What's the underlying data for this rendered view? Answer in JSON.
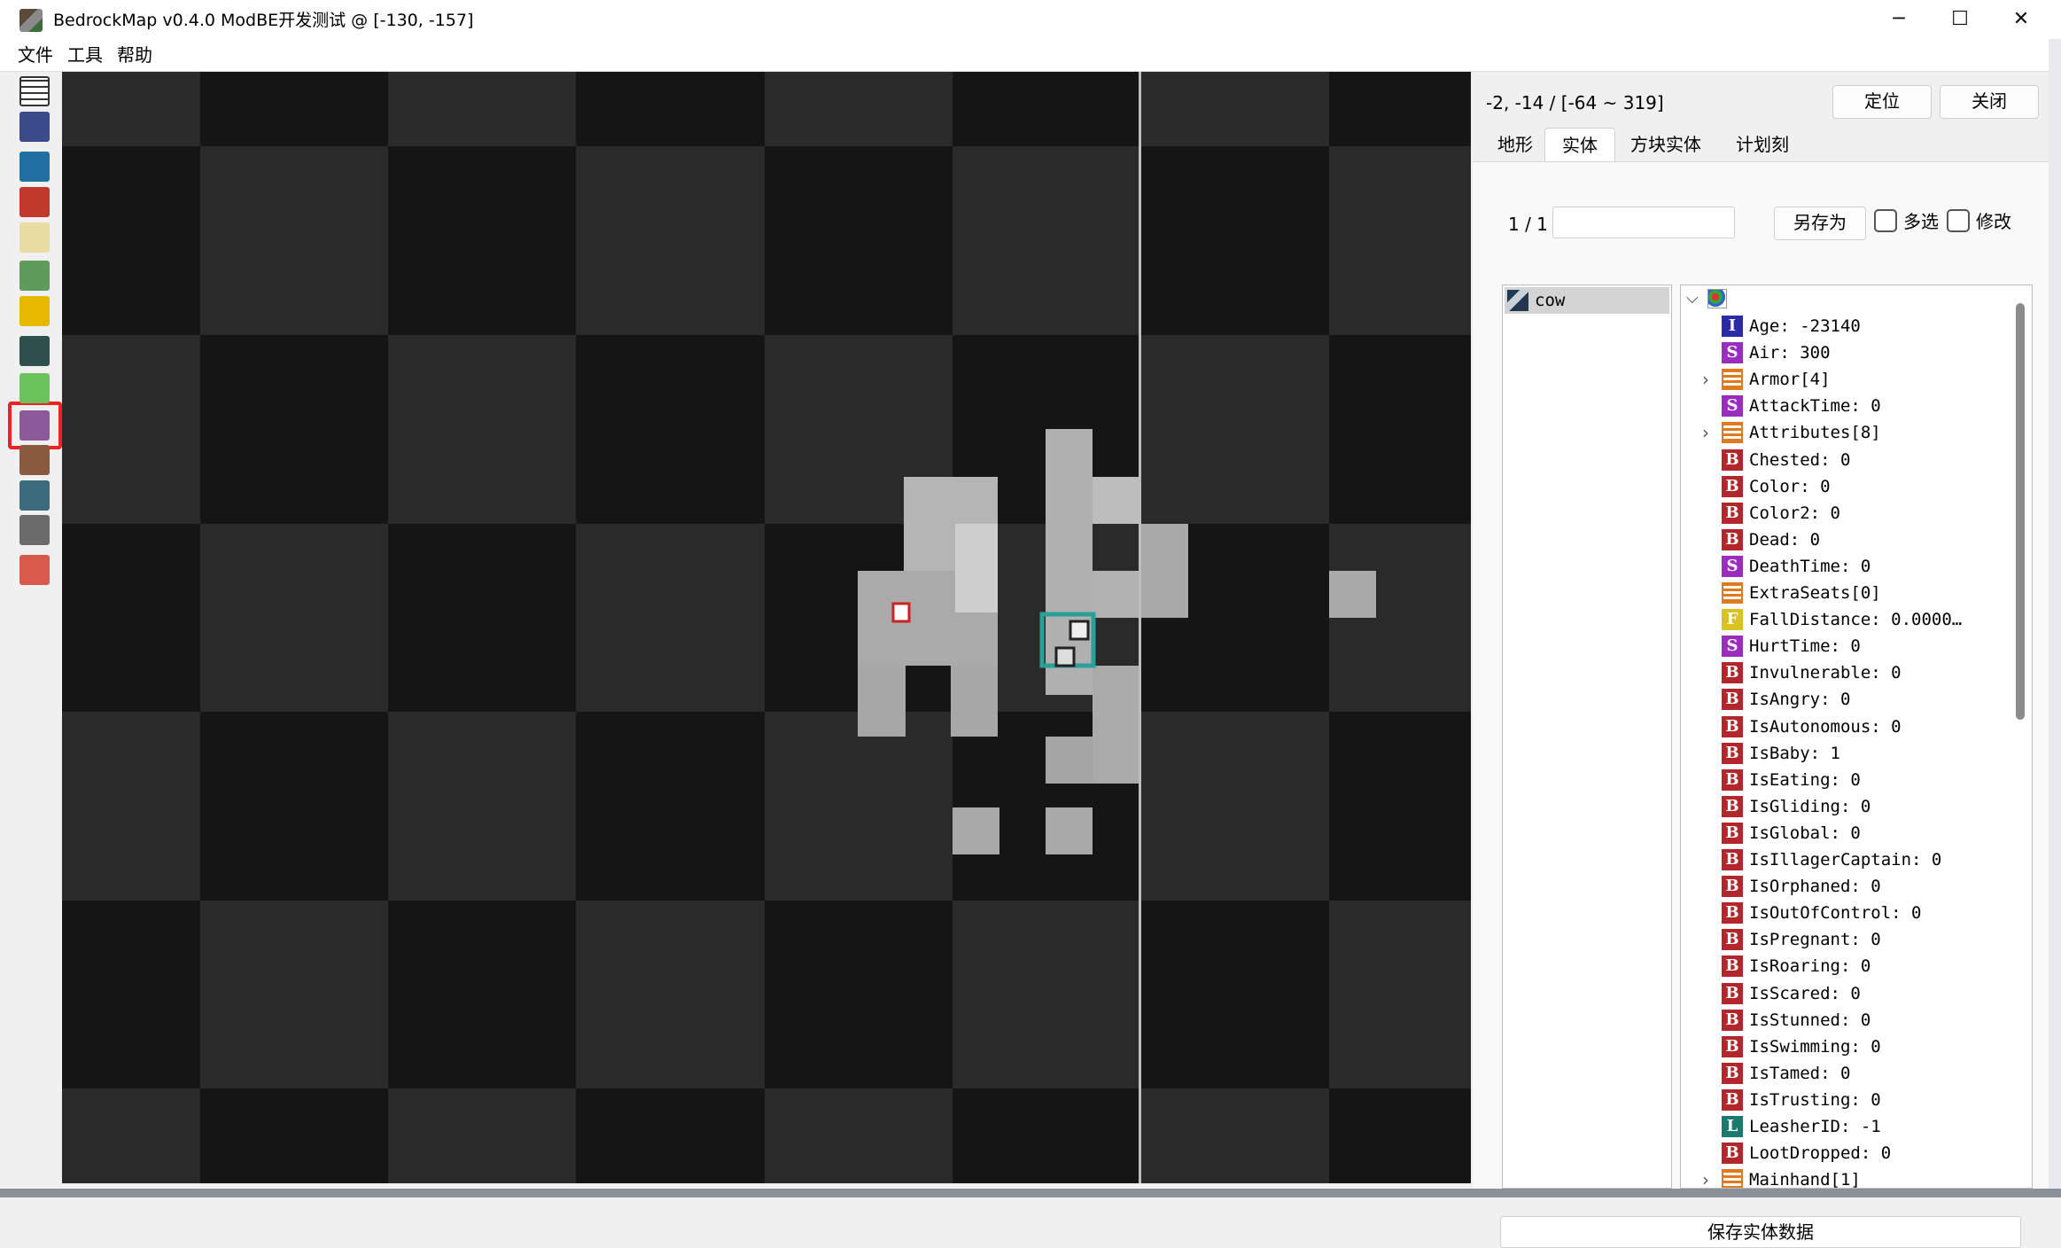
{
  "window": {
    "title": "BedrockMap v0.4.0 ModBE开发测试 @  [-130, -157]",
    "controls": {
      "minimize": "─",
      "maximize": "☐",
      "close": "✕"
    }
  },
  "menu": {
    "file": "文件",
    "tools": "工具",
    "help": "帮助"
  },
  "toolbar": {
    "tools": [
      {
        "name": "grid-tool-icon",
        "color": "#555555"
      },
      {
        "name": "selection-tool-icon",
        "color": "#3a4b8a"
      },
      {
        "name": "globe-icon",
        "color": "#1f6fa3"
      },
      {
        "name": "tnt-icon",
        "color": "#c0392b"
      },
      {
        "name": "dice-icon",
        "color": "#e9dca3"
      },
      {
        "name": "landscape-icon",
        "color": "#5d9c5a"
      },
      {
        "name": "paint-icon",
        "color": "#e4b900"
      },
      {
        "name": "entity-layer-icon",
        "color": "#2f4f4f"
      },
      {
        "name": "slime-icon",
        "color": "#6ac35b"
      },
      {
        "name": "actor-layer-icon",
        "color": "#8a5a9a"
      },
      {
        "name": "villager-icon",
        "color": "#8a5a3e"
      },
      {
        "name": "mob-layer-icon",
        "color": "#3b6c7c"
      },
      {
        "name": "anvil-icon",
        "color": "#6b6b6b"
      },
      {
        "name": "nbt-icon",
        "color": "#d95a4a"
      }
    ],
    "highlighted_tool": "entity-layer-icon"
  },
  "panel": {
    "coordinate": "-2, -14 / [-64 ~ 319]",
    "locate_button": "定位",
    "close_button": "关闭",
    "tabs": {
      "terrain": "地形",
      "entity": "实体",
      "block_entity": "方块实体",
      "scheduled_tick": "计划刻"
    },
    "active_tab": "实体",
    "page_indicator": "1 / 1",
    "search_value": "",
    "save_as_button": "另存为",
    "multi_select_label": "多选",
    "modify_label": "修改",
    "entity_list": [
      {
        "name": "cow"
      }
    ],
    "nbt_rows": [
      {
        "type": "I",
        "text": "Age: -23140",
        "color": "#2b2ba8",
        "expandable": false
      },
      {
        "type": "S",
        "text": "Air: 300",
        "color": "#9a2dbd",
        "expandable": false
      },
      {
        "type": "list",
        "text": "Armor[4]",
        "color": "#e07a1f",
        "expandable": true
      },
      {
        "type": "S",
        "text": "AttackTime: 0",
        "color": "#9a2dbd",
        "expandable": false
      },
      {
        "type": "list",
        "text": "Attributes[8]",
        "color": "#e07a1f",
        "expandable": true
      },
      {
        "type": "B",
        "text": "Chested: 0",
        "color": "#b3262c",
        "expandable": false
      },
      {
        "type": "B",
        "text": "Color: 0",
        "color": "#b3262c",
        "expandable": false
      },
      {
        "type": "B",
        "text": "Color2: 0",
        "color": "#b3262c",
        "expandable": false
      },
      {
        "type": "B",
        "text": "Dead: 0",
        "color": "#b3262c",
        "expandable": false
      },
      {
        "type": "S",
        "text": "DeathTime: 0",
        "color": "#9a2dbd",
        "expandable": false
      },
      {
        "type": "list",
        "text": "ExtraSeats[0]",
        "color": "#e07a1f",
        "expandable": false
      },
      {
        "type": "F",
        "text": "FallDistance: 0.0000…",
        "color": "#d9c323",
        "expandable": false
      },
      {
        "type": "S",
        "text": "HurtTime: 0",
        "color": "#9a2dbd",
        "expandable": false
      },
      {
        "type": "B",
        "text": "Invulnerable: 0",
        "color": "#b3262c",
        "expandable": false
      },
      {
        "type": "B",
        "text": "IsAngry: 0",
        "color": "#b3262c",
        "expandable": false
      },
      {
        "type": "B",
        "text": "IsAutonomous: 0",
        "color": "#b3262c",
        "expandable": false
      },
      {
        "type": "B",
        "text": "IsBaby: 1",
        "color": "#b3262c",
        "expandable": false
      },
      {
        "type": "B",
        "text": "IsEating: 0",
        "color": "#b3262c",
        "expandable": false
      },
      {
        "type": "B",
        "text": "IsGliding: 0",
        "color": "#b3262c",
        "expandable": false
      },
      {
        "type": "B",
        "text": "IsGlobal: 0",
        "color": "#b3262c",
        "expandable": false
      },
      {
        "type": "B",
        "text": "IsIllagerCaptain: 0",
        "color": "#b3262c",
        "expandable": false
      },
      {
        "type": "B",
        "text": "IsOrphaned: 0",
        "color": "#b3262c",
        "expandable": false
      },
      {
        "type": "B",
        "text": "IsOutOfControl: 0",
        "color": "#b3262c",
        "expandable": false
      },
      {
        "type": "B",
        "text": "IsPregnant: 0",
        "color": "#b3262c",
        "expandable": false
      },
      {
        "type": "B",
        "text": "IsRoaring: 0",
        "color": "#b3262c",
        "expandable": false
      },
      {
        "type": "B",
        "text": "IsScared: 0",
        "color": "#b3262c",
        "expandable": false
      },
      {
        "type": "B",
        "text": "IsStunned: 0",
        "color": "#b3262c",
        "expandable": false
      },
      {
        "type": "B",
        "text": "IsSwimming: 0",
        "color": "#b3262c",
        "expandable": false
      },
      {
        "type": "B",
        "text": "IsTamed: 0",
        "color": "#b3262c",
        "expandable": false
      },
      {
        "type": "B",
        "text": "IsTrusting: 0",
        "color": "#b3262c",
        "expandable": false
      },
      {
        "type": "L",
        "text": "LeasherID: -1",
        "color": "#1a7a6e",
        "expandable": false
      },
      {
        "type": "B",
        "text": "LootDropped: 0",
        "color": "#b3262c",
        "expandable": false
      },
      {
        "type": "list",
        "text": "Mainhand[1]",
        "color": "#e07a1f",
        "expandable": true
      }
    ],
    "save_entity_button": "保存实体数据"
  },
  "map": {
    "colors": {
      "dark": "#151515",
      "light": "#2a2a2a",
      "terrain": "#a9a9a9",
      "selection": "#2aa198"
    }
  }
}
